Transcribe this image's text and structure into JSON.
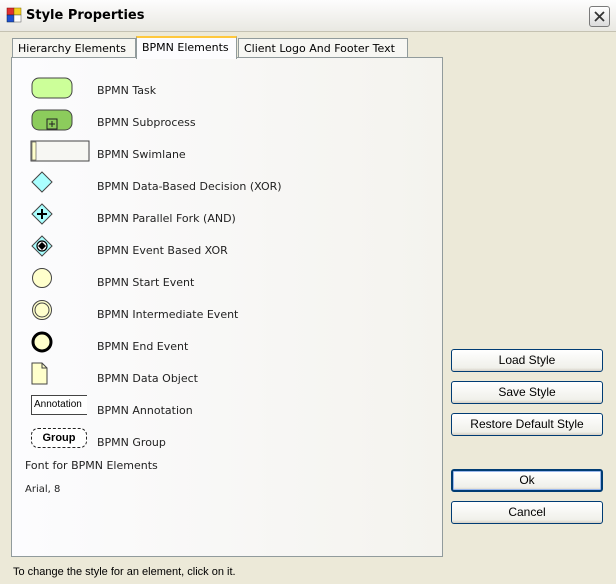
{
  "window": {
    "title": "Style Properties"
  },
  "tabs": [
    {
      "label": "Hierarchy Elements"
    },
    {
      "label": "BPMN Elements"
    },
    {
      "label": "Client Logo And Footer Text"
    }
  ],
  "elements": [
    {
      "label": "BPMN Task",
      "icon": "task-icon"
    },
    {
      "label": "BPMN Subprocess",
      "icon": "subprocess-icon"
    },
    {
      "label": "BPMN Swimlane",
      "icon": "swimlane-icon"
    },
    {
      "label": "BPMN Data-Based Decision (XOR)",
      "icon": "xor-decision-icon"
    },
    {
      "label": "BPMN Parallel Fork (AND)",
      "icon": "parallel-fork-icon"
    },
    {
      "label": "BPMN Event Based XOR",
      "icon": "event-based-xor-icon"
    },
    {
      "label": "BPMN Start Event",
      "icon": "start-event-icon"
    },
    {
      "label": "BPMN Intermediate Event",
      "icon": "intermediate-event-icon"
    },
    {
      "label": "BPMN End Event",
      "icon": "end-event-icon"
    },
    {
      "label": "BPMN Data Object",
      "icon": "data-object-icon"
    },
    {
      "label": "BPMN Annotation",
      "icon": "annotation-icon",
      "swatch_text": "Annotation"
    },
    {
      "label": "BPMN Group",
      "icon": "group-icon",
      "swatch_text": "Group"
    }
  ],
  "font": {
    "title": "Font for BPMN Elements",
    "value": "Arial, 8"
  },
  "buttons": {
    "load": "Load Style",
    "save": "Save Style",
    "restore": "Restore Default Style",
    "ok": "Ok",
    "cancel": "Cancel"
  },
  "status": {
    "hint": "To change the style for an element, click on it."
  },
  "colors": {
    "task_fill": "#ccff99",
    "subprocess_fill": "#8ccc5c",
    "swimlane_fill": "#ffffcc",
    "gateway_fill": "#aaffff",
    "event_fill": "#ffffcc",
    "data_object_fill": "#ffffcc",
    "active_tab_accent": "#ffc83c"
  }
}
